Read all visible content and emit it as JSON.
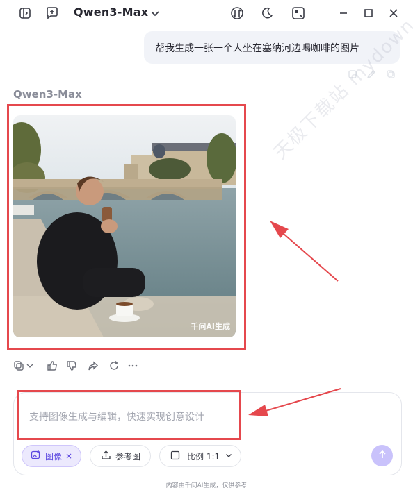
{
  "header": {
    "model_name": "Qwen3-Max",
    "icons": [
      "sidebar-toggle-icon",
      "new-chat-icon",
      "chevron-down-icon",
      "data-sync-icon",
      "moon-icon",
      "screenshot-icon",
      "minimize-icon",
      "maximize-icon",
      "close-icon"
    ]
  },
  "conversation": {
    "user_message": "帮我生成一张一个人坐在塞纳河边喝咖啡的图片",
    "assistant_name": "Qwen3-Max",
    "image_watermark": "千问AI生成",
    "message_actions": [
      "copy-icon",
      "thumbs-up-icon",
      "thumbs-down-icon",
      "share-icon",
      "regenerate-icon",
      "more-icon"
    ]
  },
  "watermark": "天极下载站 mydown.yesky.com",
  "composer": {
    "placeholder": "支持图像生成与编辑，快速实现创意设计",
    "chip_image_label": "图像",
    "chip_image_remove": "×",
    "chip_reference_label": "参考图",
    "chip_ratio_label": "比例 1:1",
    "send_icon": "arrow-up-icon"
  },
  "footer": {
    "note": "内容由千问AI生成，仅供参考"
  },
  "colors": {
    "accent": "#5b47e0",
    "annotation_red": "#e5484d",
    "send_disabled": "#c9c2fb"
  }
}
